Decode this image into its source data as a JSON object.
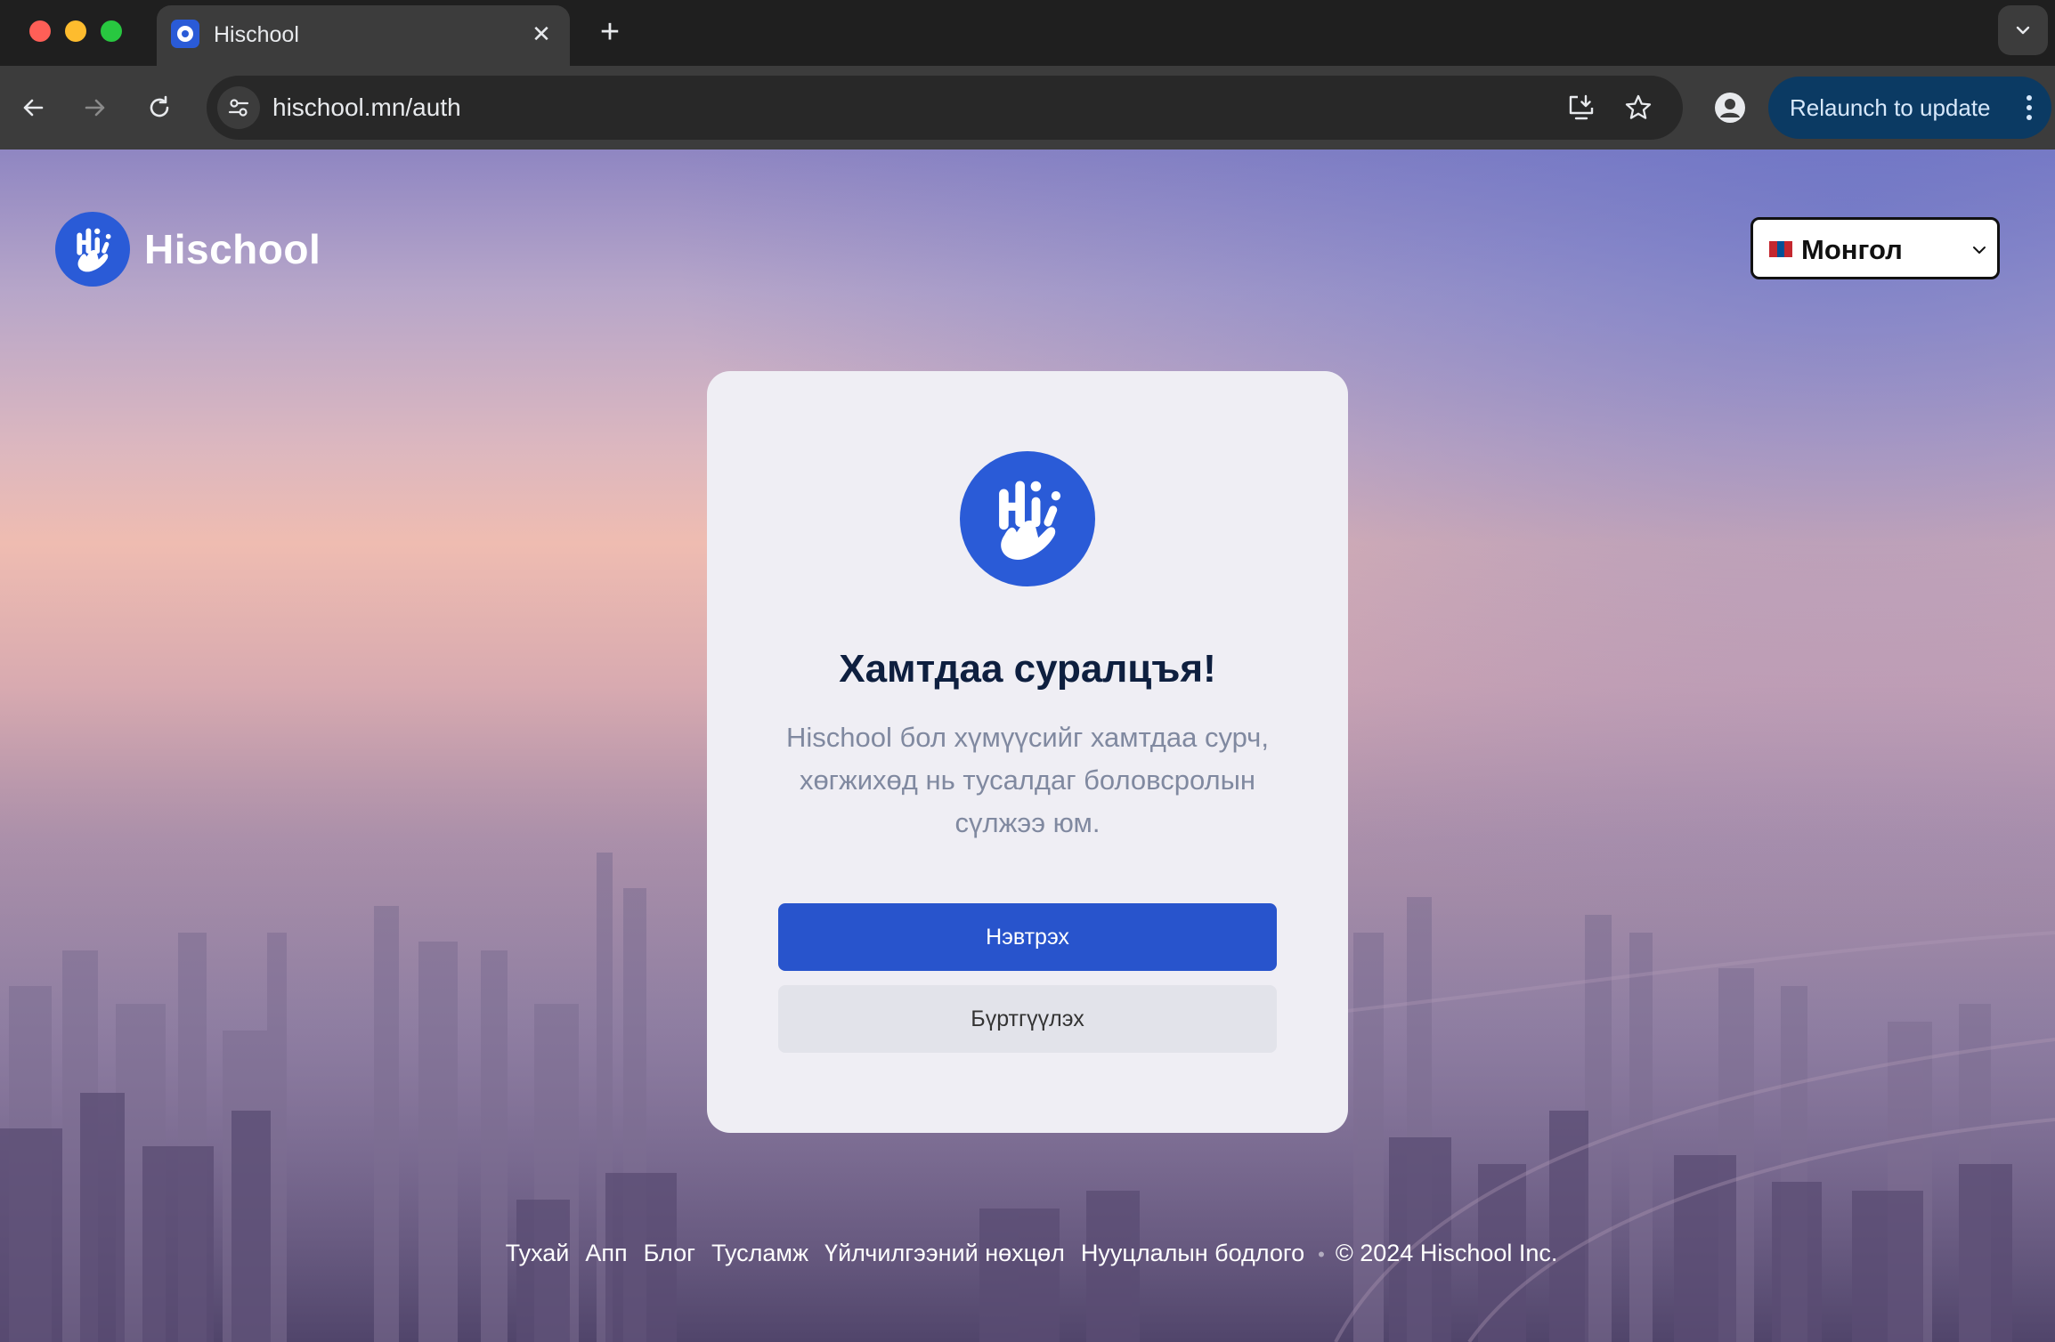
{
  "browser": {
    "tab_title": "Hischool",
    "url": "hischool.mn/auth",
    "relaunch_label": "Relaunch to update"
  },
  "header": {
    "brand_name": "Hischool",
    "language": "Монгол"
  },
  "card": {
    "title": "Хамтдаа суралцъя!",
    "description": "Hischool бол хүмүүсийг хамтдаа сурч, хөгжихөд нь тусалдаг боловсролын сүлжээ юм.",
    "login_label": "Нэвтрэх",
    "register_label": "Бүртгүүлэх"
  },
  "footer": {
    "links": [
      "Тухай",
      "Апп",
      "Блог",
      "Тусламж",
      "Үйлчилгээний нөхцөл",
      "Нууцлалын бодлого"
    ],
    "separator": "•",
    "copyright": "© 2024 Hischool Inc."
  },
  "colors": {
    "brand": "#2a5bd7",
    "primary_button": "#2854cc",
    "title": "#0e1f3f"
  }
}
